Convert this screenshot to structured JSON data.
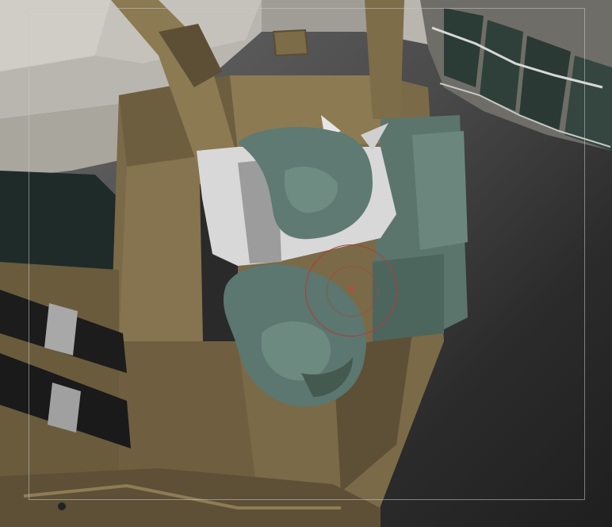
{
  "canvas": {
    "background_colors": [
      "#6a6a6a",
      "#1f1f1f"
    ],
    "model_colors": {
      "armor_plate": "#7a6a48",
      "armor_shadow": "#4a3f2a",
      "sculpt_clay": "#5e7a72",
      "highlight_clay": "#d8d8d8",
      "pad_gray": "#b9b6ae",
      "strap_black": "#1c1c1c",
      "buckle_silver": "#a8a8a8"
    }
  },
  "brush": {
    "icon": "brush-circle-cursor",
    "color": "#b43a3a"
  }
}
